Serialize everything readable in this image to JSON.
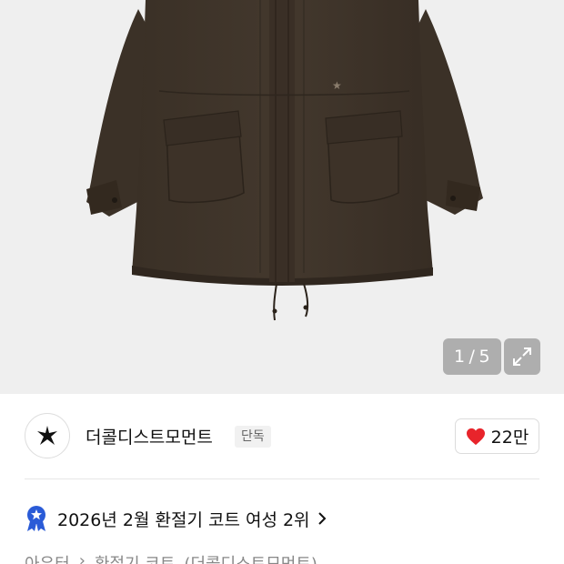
{
  "gallery": {
    "current_page": "1",
    "separator": "/",
    "total_pages": "5"
  },
  "brand": {
    "name": "더콜디스트모먼트",
    "badge": "단독"
  },
  "likes": {
    "count": "22만"
  },
  "ranking": {
    "text": "2026년 2월 환절기 코트 여성 2위"
  },
  "breadcrumb": {
    "items": [
      "아우터",
      "›",
      "환절기 코트",
      "(더콜디스트모먼트)"
    ]
  },
  "colors": {
    "heart": "#e8242b",
    "rank_badge": "#2a5bd7",
    "jacket": "#3e3329"
  }
}
